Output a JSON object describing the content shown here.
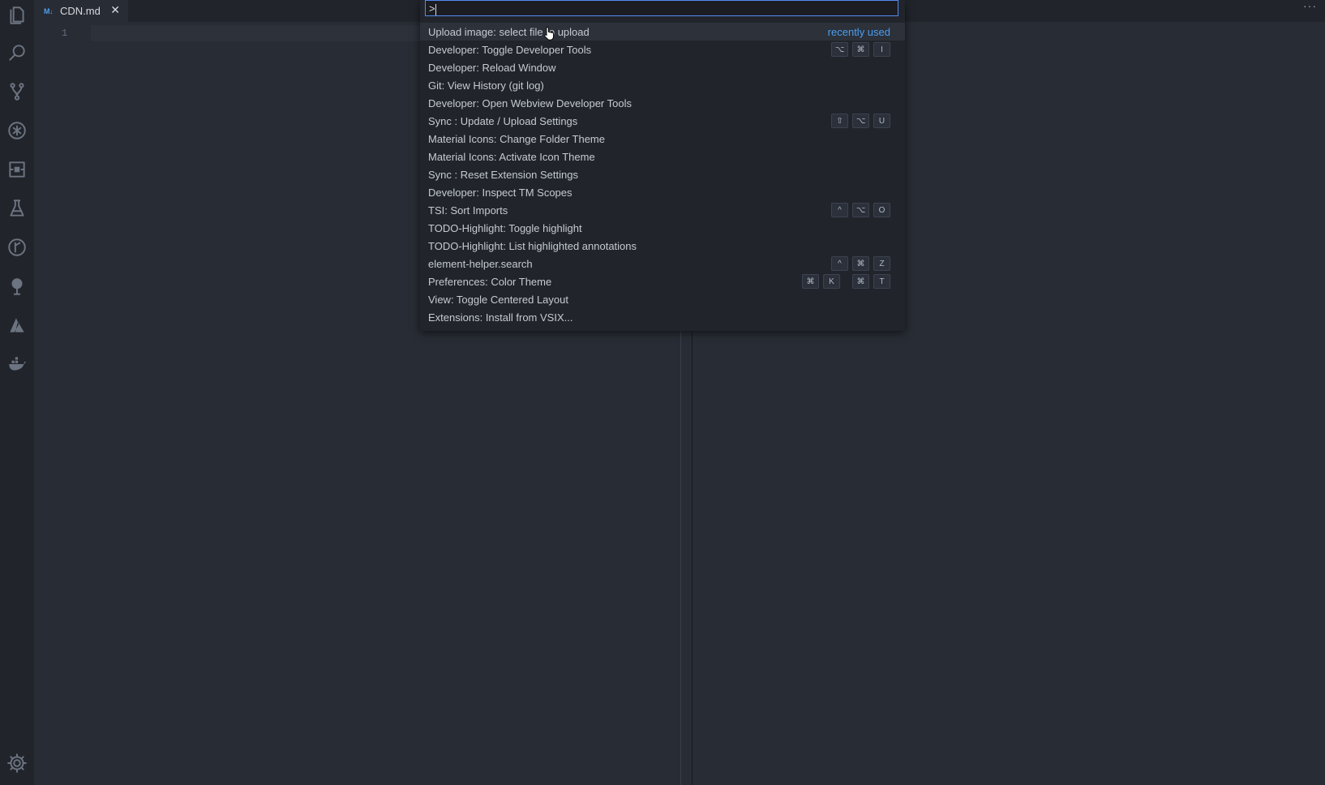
{
  "activity_bar": {
    "icons": [
      "files-icon",
      "search-icon",
      "source-control-icon",
      "debug-icon",
      "extensions-icon",
      "test-flask-icon",
      "git-history-icon",
      "tree-icon",
      "azure-icon",
      "docker-icon"
    ],
    "settings_icon": "gear-icon"
  },
  "tabs": [
    {
      "icon_text": "M↓",
      "label": "CDN.md",
      "close": "✕"
    }
  ],
  "editor": {
    "line_numbers": [
      "1"
    ],
    "more_actions": "···"
  },
  "command_palette": {
    "input_value": ">",
    "items": [
      {
        "label": "Upload image: select file to upload",
        "tag": "recently used",
        "keys": []
      },
      {
        "label": "Developer: Toggle Developer Tools",
        "tag": "",
        "keys": [
          "⌥",
          "⌘",
          "I"
        ]
      },
      {
        "label": "Developer: Reload Window",
        "tag": "",
        "keys": []
      },
      {
        "label": "Git: View History (git log)",
        "tag": "",
        "keys": []
      },
      {
        "label": "Developer: Open Webview Developer Tools",
        "tag": "",
        "keys": []
      },
      {
        "label": "Sync : Update / Upload Settings",
        "tag": "",
        "keys": [
          "⇧",
          "⌥",
          "U"
        ]
      },
      {
        "label": "Material Icons: Change Folder Theme",
        "tag": "",
        "keys": []
      },
      {
        "label": "Material Icons: Activate Icon Theme",
        "tag": "",
        "keys": []
      },
      {
        "label": "Sync : Reset Extension Settings",
        "tag": "",
        "keys": []
      },
      {
        "label": "Developer: Inspect TM Scopes",
        "tag": "",
        "keys": []
      },
      {
        "label": "TSI: Sort Imports",
        "tag": "",
        "keys": [
          "^",
          "⌥",
          "O"
        ]
      },
      {
        "label": "TODO-Highlight: Toggle highlight",
        "tag": "",
        "keys": []
      },
      {
        "label": "TODO-Highlight: List highlighted annotations",
        "tag": "",
        "keys": []
      },
      {
        "label": "element-helper.search",
        "tag": "",
        "keys": [
          "^",
          "⌘",
          "Z"
        ]
      },
      {
        "label": "Preferences: Color Theme",
        "tag": "",
        "keys": [
          "⌘",
          "K",
          "|",
          "⌘",
          "T"
        ]
      },
      {
        "label": "View: Toggle Centered Layout",
        "tag": "",
        "keys": []
      },
      {
        "label": "Extensions: Install from VSIX...",
        "tag": "",
        "keys": []
      }
    ]
  },
  "colors": {
    "background": "#282c34",
    "sidebar": "#21252b",
    "accent": "#568af2",
    "tag": "#4d9ef0"
  }
}
